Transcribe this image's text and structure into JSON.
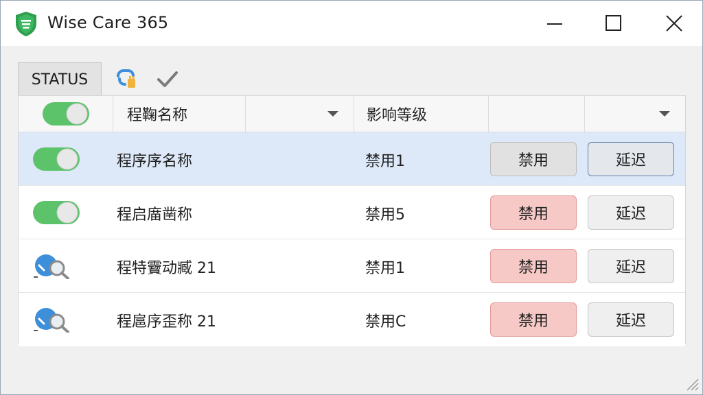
{
  "window": {
    "title": "Wise Care 365"
  },
  "toolbar": {
    "status_label": "STATUS"
  },
  "table": {
    "columns": {
      "name": "程鞠名称",
      "level": "影响等级"
    },
    "rows": [
      {
        "icon": "toggle-on-icon",
        "name": "程序序名称",
        "level": "禁用1",
        "disable_label": "禁用",
        "delay_label": "延迟",
        "selected": true,
        "disable_style": "grey"
      },
      {
        "icon": "toggle-on-icon",
        "name": "程启庿凿称",
        "level": "禁用5",
        "disable_label": "禁用",
        "delay_label": "延迟",
        "selected": false,
        "disable_style": "red"
      },
      {
        "icon": "search-icon",
        "name": "程特靌动臧 21",
        "level": "禁用1",
        "disable_label": "禁用",
        "delay_label": "延迟",
        "selected": false,
        "disable_style": "red"
      },
      {
        "icon": "search-icon",
        "name": "程扈序歪称 21",
        "level": "禁用C",
        "disable_label": "禁用",
        "delay_label": "延迟",
        "selected": false,
        "disable_style": "red"
      }
    ]
  },
  "colors": {
    "toggle_on": "#5cc36a",
    "disable_red": "#f6c9c7",
    "selected_row": "#dde9f8",
    "brand_green": "#2e9e4f"
  }
}
